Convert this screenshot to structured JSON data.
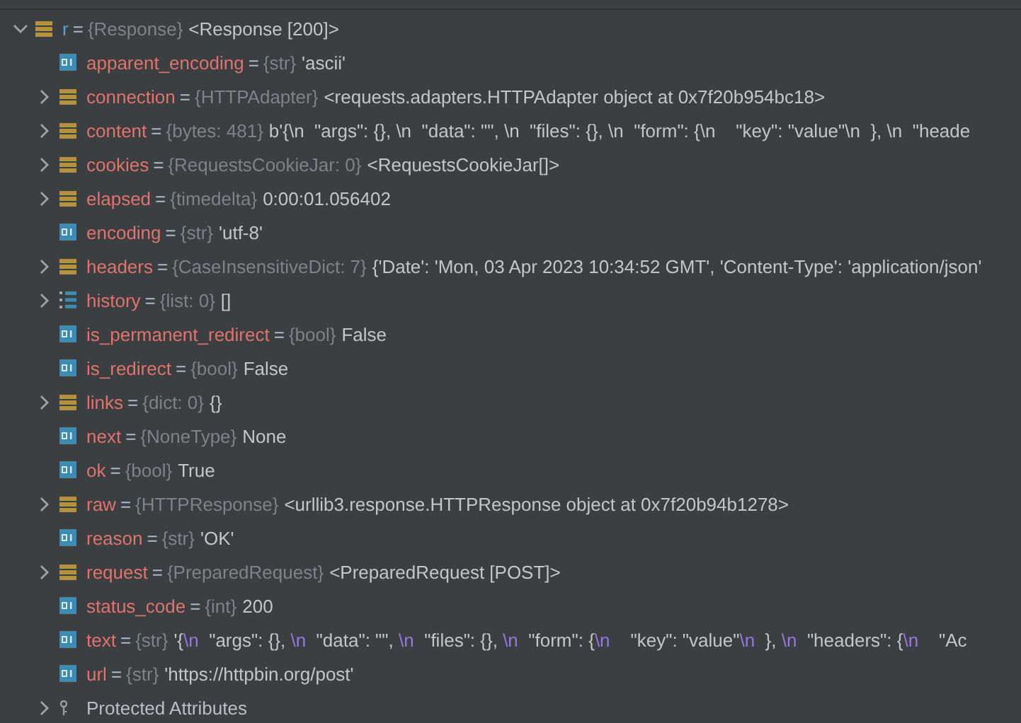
{
  "tree": [
    {
      "name": "r",
      "eq": "=",
      "type": "{Response}",
      "value": "<Response [200]>",
      "kind": "object",
      "expanded": true,
      "children": [
        {
          "name": "apparent_encoding",
          "eq": "=",
          "type": "{str}",
          "value": "'ascii'",
          "kind": "primitive"
        },
        {
          "name": "connection",
          "eq": "=",
          "type": "{HTTPAdapter}",
          "value": "<requests.adapters.HTTPAdapter object at 0x7f20b954bc18>",
          "kind": "object",
          "expanded": false
        },
        {
          "name": "content",
          "eq": "=",
          "type": "{bytes: 481}",
          "value": "b'{\\n  \"args\": {}, \\n  \"data\": \"\", \\n  \"files\": {}, \\n  \"form\": {\\n    \"key\": \"value\"\\n  }, \\n  \"heade",
          "kind": "object",
          "expanded": false
        },
        {
          "name": "cookies",
          "eq": "=",
          "type": "{RequestsCookieJar: 0}",
          "value": "<RequestsCookieJar[]>",
          "kind": "object",
          "expanded": false
        },
        {
          "name": "elapsed",
          "eq": "=",
          "type": "{timedelta}",
          "value": "0:00:01.056402",
          "kind": "object",
          "expanded": false
        },
        {
          "name": "encoding",
          "eq": "=",
          "type": "{str}",
          "value": "'utf-8'",
          "kind": "primitive"
        },
        {
          "name": "headers",
          "eq": "=",
          "type": "{CaseInsensitiveDict: 7}",
          "value": "{'Date': 'Mon, 03 Apr 2023 10:34:52 GMT', 'Content-Type': 'application/json'",
          "kind": "object",
          "expanded": false
        },
        {
          "name": "history",
          "eq": "=",
          "type": "{list: 0}",
          "value": "[]",
          "kind": "list",
          "expanded": false
        },
        {
          "name": "is_permanent_redirect",
          "eq": "=",
          "type": "{bool}",
          "value": "False",
          "kind": "primitive"
        },
        {
          "name": "is_redirect",
          "eq": "=",
          "type": "{bool}",
          "value": "False",
          "kind": "primitive"
        },
        {
          "name": "links",
          "eq": "=",
          "type": "{dict: 0}",
          "value": "{}",
          "kind": "object",
          "expanded": false
        },
        {
          "name": "next",
          "eq": "=",
          "type": "{NoneType}",
          "value": "None",
          "kind": "primitive"
        },
        {
          "name": "ok",
          "eq": "=",
          "type": "{bool}",
          "value": "True",
          "kind": "primitive"
        },
        {
          "name": "raw",
          "eq": "=",
          "type": "{HTTPResponse}",
          "value": "<urllib3.response.HTTPResponse object at 0x7f20b94b1278>",
          "kind": "object",
          "expanded": false
        },
        {
          "name": "reason",
          "eq": "=",
          "type": "{str}",
          "value": "'OK'",
          "kind": "primitive"
        },
        {
          "name": "request",
          "eq": "=",
          "type": "{PreparedRequest}",
          "value": "<PreparedRequest [POST]>",
          "kind": "object",
          "expanded": false
        },
        {
          "name": "status_code",
          "eq": "=",
          "type": "{int}",
          "value": "200",
          "kind": "primitive"
        },
        {
          "name": "text",
          "eq": "=",
          "type": "{str}",
          "value_parts": [
            {
              "text": "'{",
              "escape": false
            },
            {
              "text": "\\n",
              "escape": true
            },
            {
              "text": "  \"args\": {}, ",
              "escape": false
            },
            {
              "text": "\\n",
              "escape": true
            },
            {
              "text": "  \"data\": \"\", ",
              "escape": false
            },
            {
              "text": "\\n",
              "escape": true
            },
            {
              "text": "  \"files\": {}, ",
              "escape": false
            },
            {
              "text": "\\n",
              "escape": true
            },
            {
              "text": "  \"form\": {",
              "escape": false
            },
            {
              "text": "\\n",
              "escape": true
            },
            {
              "text": "    \"key\": \"value\"",
              "escape": false
            },
            {
              "text": "\\n",
              "escape": true
            },
            {
              "text": "  }, ",
              "escape": false
            },
            {
              "text": "\\n",
              "escape": true
            },
            {
              "text": "  \"headers\": {",
              "escape": false
            },
            {
              "text": "\\n",
              "escape": true
            },
            {
              "text": "    \"Ac",
              "escape": false
            }
          ],
          "kind": "primitive"
        },
        {
          "name": "url",
          "eq": "=",
          "type": "{str}",
          "value": "'https://httpbin.org/post'",
          "kind": "primitive"
        },
        {
          "label": "Protected Attributes",
          "kind": "protected",
          "expanded": false
        }
      ]
    }
  ]
}
